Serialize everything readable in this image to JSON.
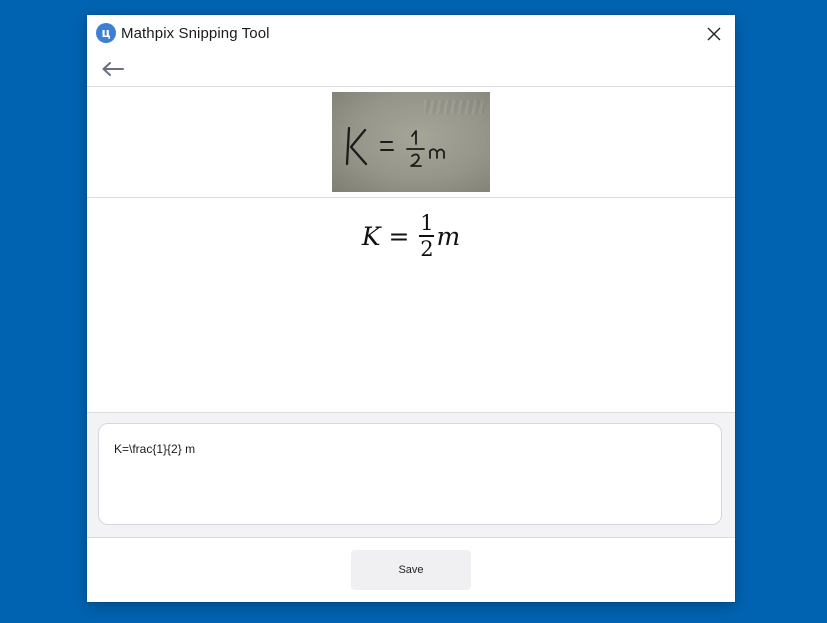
{
  "window": {
    "title": "Mathpix Snipping Tool",
    "logo_glyph": "ц"
  },
  "colors": {
    "desktop": "#0063b1",
    "logo": "#3f7fd3"
  },
  "icons": {
    "logo": "mathpix-logo-icon",
    "close": "close-icon",
    "back": "back-arrow-icon"
  },
  "snip": {
    "k": "K",
    "eq": "=",
    "num": "1",
    "den": "2",
    "m": "m"
  },
  "rendered": {
    "lhs": "K",
    "op": "=",
    "numerator": "1",
    "denominator": "2",
    "rhs": "m"
  },
  "editor": {
    "value": "K=\\frac{1}{2} m"
  },
  "footer": {
    "save_label": "Save"
  }
}
